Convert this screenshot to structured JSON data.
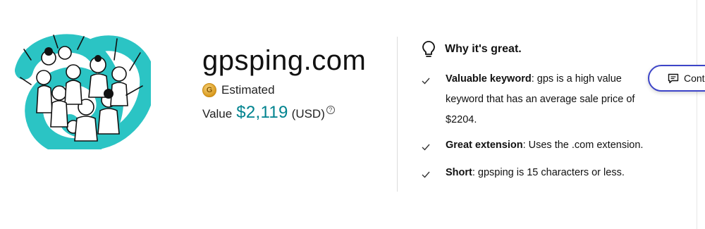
{
  "domain": {
    "name": "gpsping.com",
    "coin_letter": "G",
    "estimate_label": "Estimated",
    "value_label": "Value",
    "value_amount": "$2,119",
    "value_currency": "(USD)",
    "info_symbol": "?"
  },
  "why": {
    "title": "Why it's great.",
    "reasons": [
      {
        "title": "Valuable keyword",
        "text": ": gps is a high value keyword that has an average sale price of $2204."
      },
      {
        "title": "Great extension",
        "text": ": Uses the .com extension."
      },
      {
        "title": "Short",
        "text": ": gpsping is 15 characters or less."
      }
    ]
  },
  "contact": {
    "label": "Cont"
  },
  "colors": {
    "accent": "#00838f",
    "logo_teal": "#2bc4c4",
    "button_border": "#3d45c8"
  }
}
